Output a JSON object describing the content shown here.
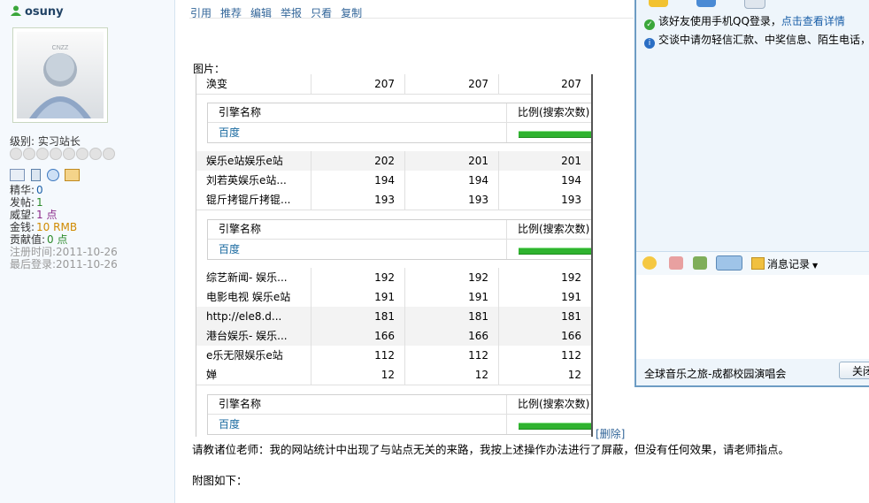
{
  "user": {
    "name": "osuny",
    "avatar_text": "CNZZ",
    "level_label": "级别:",
    "level_value": "实习站长",
    "stats": [
      {
        "label": "精华:",
        "value": "0",
        "color": "#1a5fa8"
      },
      {
        "label": "发帖:",
        "value": "1",
        "color": "#2a8a2a"
      },
      {
        "label": "威望:",
        "value": "1 点",
        "color": "#8a2a8a"
      },
      {
        "label": "金钱:",
        "value": "10 RMB",
        "color": "#d08a00"
      },
      {
        "label": "贡献值:",
        "value": "0 点",
        "color": "#2a8a2a"
      }
    ],
    "reg_time": "注册时间:2011-10-26",
    "last_login": "最后登录:2011-10-26"
  },
  "post_actions": [
    "引用",
    "推荐",
    "编辑",
    "举报",
    "只看",
    "复制"
  ],
  "picture_label": "图片：",
  "stats_table": {
    "rows_a": [
      {
        "name": "涣变",
        "v1": "207",
        "v2": "207",
        "v3": "207"
      }
    ],
    "engine_block": {
      "col1": "引擎名称",
      "col2": "比例(搜索次数)",
      "engine": "百度"
    },
    "rows_b": [
      {
        "name": "娱乐e站娱乐e站",
        "v1": "202",
        "v2": "201",
        "v3": "201"
      },
      {
        "name": "刘若英娱乐e站...",
        "v1": "194",
        "v2": "194",
        "v3": "194"
      },
      {
        "name": "锟斤拷锟斤拷锟...",
        "v1": "193",
        "v2": "193",
        "v3": "193"
      }
    ],
    "rows_c": [
      {
        "name": "综艺新闻- 娱乐...",
        "v1": "192",
        "v2": "192",
        "v3": "192"
      },
      {
        "name": "电影电视 娱乐e站",
        "v1": "191",
        "v2": "191",
        "v3": "191"
      },
      {
        "name": "http://ele8.d...",
        "v1": "181",
        "v2": "181",
        "v3": "181"
      },
      {
        "name": "港台娱乐- 娱乐...",
        "v1": "166",
        "v2": "166",
        "v3": "166"
      },
      {
        "name": "e乐无限娱乐e站",
        "v1": "112",
        "v2": "112",
        "v3": "112"
      },
      {
        "name": "婵",
        "v1": "12",
        "v2": "12",
        "v3": "12"
      }
    ]
  },
  "delete_link": "[删除]",
  "post_text": "请教诸位老师：我的网站统计中出现了与站点无关的来路，我按上述操作办法进行了屏蔽，但没有任何效果，请老师指点。",
  "post_text2": "附图如下：",
  "qq": {
    "note1_prefix": "该好友使用手机QQ登录，",
    "note1_link": "点击查看详情",
    "note2": "交谈中请勿轻信汇款、中奖信息、陌生电话，",
    "msg_record": "消息记录",
    "bottom_text": "全球音乐之旅-成都校园演唱会",
    "close_label": "关闭"
  }
}
